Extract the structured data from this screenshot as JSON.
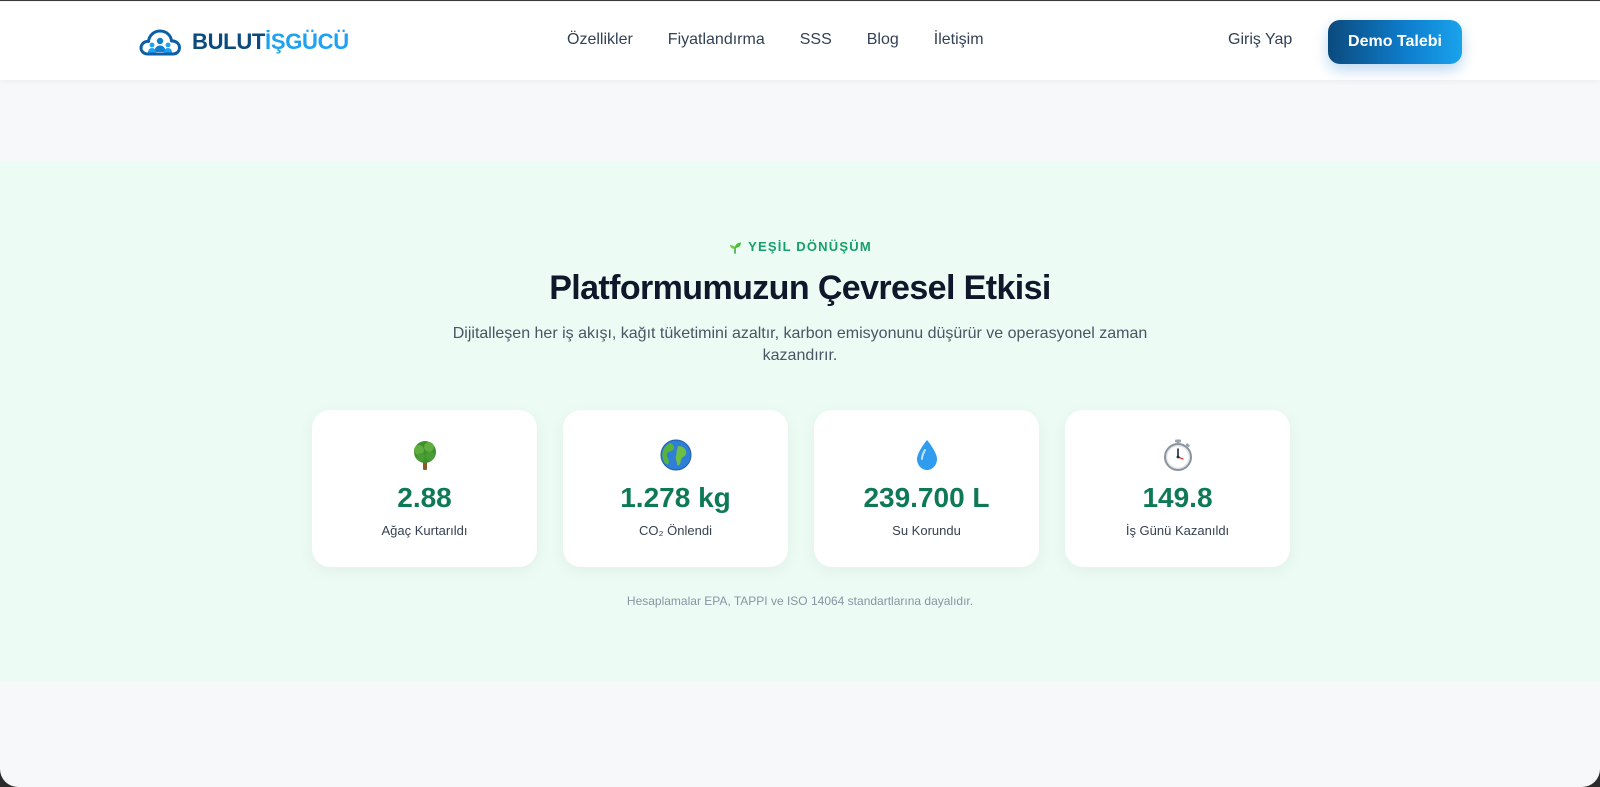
{
  "header": {
    "logo": {
      "part1": "BULUT",
      "part2": "İŞGÜCÜ"
    },
    "nav_items": [
      "Özellikler",
      "Fiyatlandırma",
      "SSS",
      "Blog",
      "İletişim"
    ],
    "login_label": "Giriş Yap",
    "demo_label": "Demo Talebi"
  },
  "impact": {
    "eyebrow": "YEŞİL DÖNÜŞÜM",
    "title": "Platformumuzun Çevresel Etkisi",
    "description": "Dijitalleşen her iş akışı, kağıt tüketimini azaltır, karbon emisyonunu düşürür ve operasyonel zaman kazandırır.",
    "stats": [
      {
        "icon": "tree-icon",
        "value": "2.88",
        "label": "Ağaç Kurtarıldı"
      },
      {
        "icon": "globe-icon",
        "value": "1.278 kg",
        "label": "CO₂ Önlendi"
      },
      {
        "icon": "water-drop-icon",
        "value": "239.700 L",
        "label": "Su Korundu"
      },
      {
        "icon": "stopwatch-icon",
        "value": "149.8",
        "label": "İş Günü Kazanıldı"
      }
    ],
    "footnote": "Hesaplamalar EPA, TAPPI ve ISO 14064 standartlarına dayalıdır."
  },
  "colors": {
    "brand_dark": "#0b4a7d",
    "brand_light": "#1da1f2",
    "section_bg": "#ecfbf4",
    "accent_green": "#15a06a",
    "stat_value": "#0e7a55"
  }
}
